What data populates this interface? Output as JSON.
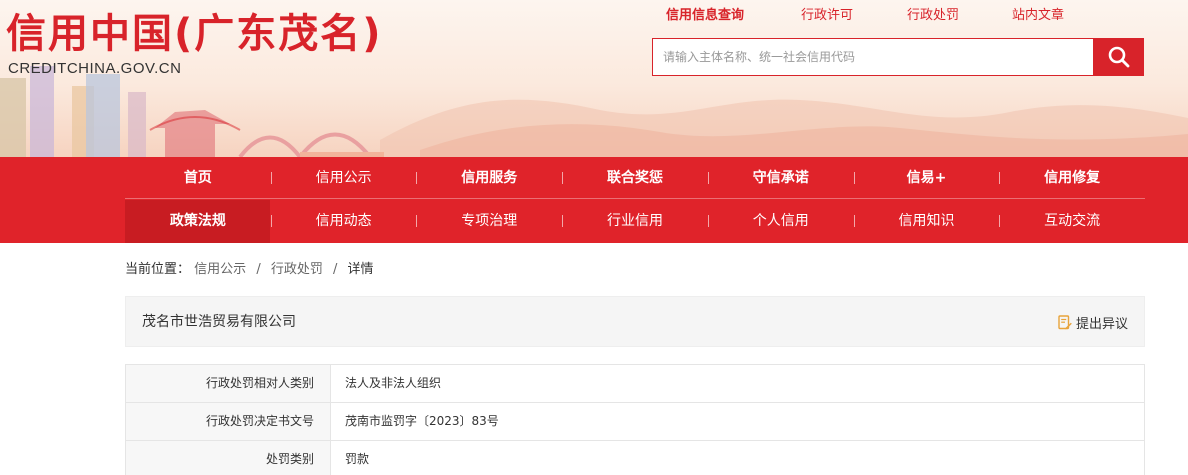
{
  "header": {
    "logo_cn": "信用中国(广东茂名)",
    "logo_en": "CREDITCHINA.GOV.CN",
    "top_links": [
      {
        "label": "信用信息查询",
        "active": true
      },
      {
        "label": "行政许可",
        "active": false
      },
      {
        "label": "行政处罚",
        "active": false
      },
      {
        "label": "站内文章",
        "active": false
      }
    ],
    "search": {
      "placeholder": "请输入主体名称、统一社会信用代码",
      "value": "",
      "button_icon": "search-icon"
    }
  },
  "nav": {
    "row1": [
      "首页",
      "信用公示",
      "信用服务",
      "联合奖惩",
      "守信承诺",
      "信易+",
      "信用修复"
    ],
    "row2": [
      "政策法规",
      "信用动态",
      "专项治理",
      "行业信用",
      "个人信用",
      "信用知识",
      "互动交流"
    ]
  },
  "breadcrumb": {
    "prefix": "当前位置：",
    "items": [
      "信用公示",
      "行政处罚"
    ],
    "current": "详情",
    "separator": "/"
  },
  "detail": {
    "company": "茂名市世浩贸易有限公司",
    "objection_label": "提出异议",
    "objection_icon": "edit-note-icon",
    "rows": [
      {
        "label": "行政处罚相对人类别",
        "value": "法人及非法人组织"
      },
      {
        "label": "行政处罚决定书文号",
        "value": "茂南市监罚字〔2023〕83号"
      },
      {
        "label": "处罚类别",
        "value": "罚款"
      }
    ]
  },
  "colors": {
    "brand_red": "#e0232a",
    "nav_active": "#c81c22",
    "icon_orange": "#e8a33b"
  }
}
